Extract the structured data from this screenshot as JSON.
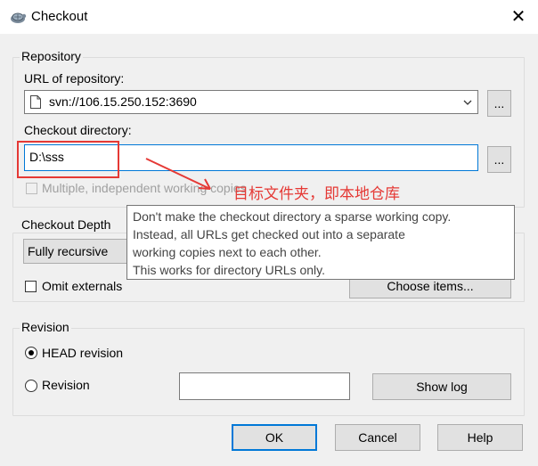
{
  "window": {
    "title": "Checkout",
    "close_glyph": "✕"
  },
  "repository": {
    "group_label": "Repository",
    "url_label": "URL of repository:",
    "url_value": "svn://106.15.250.152:3690",
    "browse_label": "...",
    "dir_label": "Checkout directory:",
    "dir_value": "D:\\sss",
    "dir_browse_label": "...",
    "multiple_label": "Multiple, independent working copies"
  },
  "depth": {
    "group_label": "Checkout Depth",
    "selected": "Fully recursive",
    "omit_externals_label": "Omit externals",
    "choose_items_label": "Choose items..."
  },
  "tooltip": {
    "lines": [
      "Don't make the checkout directory a sparse working copy.",
      "Instead, all URLs get checked out into a separate",
      "working copies next to each other.",
      "This works for directory URLs only."
    ]
  },
  "annotation": {
    "text": "目标文件夹，即本地仓库",
    "color": "#e53935"
  },
  "revision": {
    "group_label": "Revision",
    "head_label": "HEAD revision",
    "revision_label": "Revision",
    "revision_value": "",
    "show_log_label": "Show log"
  },
  "buttons": {
    "ok": "OK",
    "cancel": "Cancel",
    "help": "Help"
  },
  "colors": {
    "accent": "#0078d7",
    "annotation": "#e53935"
  },
  "icons": {
    "app": "tortoisesvn-icon",
    "close": "close-icon",
    "dropdown": "chevron-down-icon",
    "file": "file-icon"
  }
}
